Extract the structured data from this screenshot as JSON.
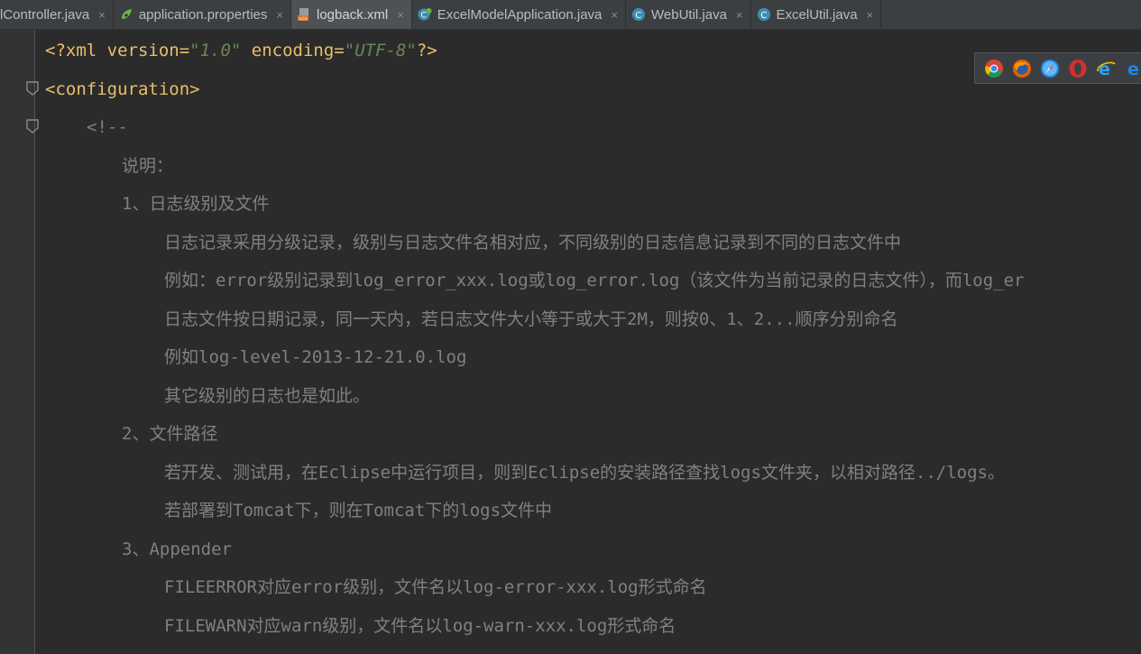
{
  "tabs": [
    {
      "label": "lController.java",
      "icon": "java-class-icon",
      "active": false
    },
    {
      "label": "application.properties",
      "icon": "spring-properties-icon",
      "active": false
    },
    {
      "label": "logback.xml",
      "icon": "xml-file-icon",
      "active": true
    },
    {
      "label": "ExcelModelApplication.java",
      "icon": "spring-boot-class-icon",
      "active": false
    },
    {
      "label": "WebUtil.java",
      "icon": "java-class-icon",
      "active": false
    },
    {
      "label": "ExcelUtil.java",
      "icon": "java-class-icon",
      "active": false
    }
  ],
  "close_glyph": "×",
  "code": {
    "l1": {
      "p1": "<?xml version=",
      "v1": "\"1.0\"",
      "p2": " encoding=",
      "v2": "\"UTF-8\"",
      "p3": "?>"
    },
    "l2": "<configuration>",
    "l3": "<!--",
    "l4": "说明：",
    "l5": "1、日志级别及文件",
    "l6": "日志记录采用分级记录，级别与日志文件名相对应，不同级别的日志信息记录到不同的日志文件中",
    "l7": "例如：error级别记录到log_error_xxx.log或log_error.log（该文件为当前记录的日志文件），而log_er",
    "l8": "日志文件按日期记录，同一天内，若日志文件大小等于或大于2M，则按0、1、2...顺序分别命名",
    "l9": "例如log-level-2013-12-21.0.log",
    "l10": "其它级别的日志也是如此。",
    "l11": "2、文件路径",
    "l12": "若开发、测试用，在Eclipse中运行项目，则到Eclipse的安装路径查找logs文件夹，以相对路径../logs。",
    "l13": "若部署到Tomcat下，则在Tomcat下的logs文件中",
    "l14": "3、Appender",
    "l15": "FILEERROR对应error级别，文件名以log-error-xxx.log形式命名",
    "l16": "FILEWARN对应warn级别，文件名以log-warn-xxx.log形式命名"
  },
  "browsers": [
    "chrome-icon",
    "firefox-icon",
    "safari-icon",
    "opera-icon",
    "ie-icon",
    "edge-icon"
  ],
  "colors": {
    "background": "#2b2b2b",
    "tag": "#e8bf6a",
    "string": "#6a8759",
    "comment": "#808080"
  }
}
